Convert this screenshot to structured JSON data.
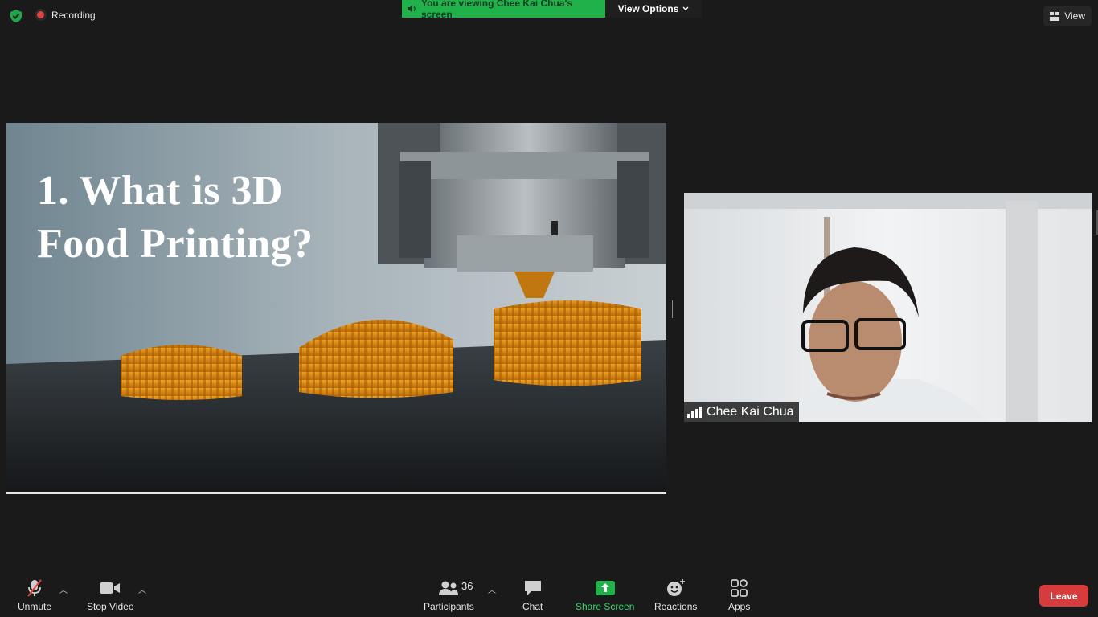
{
  "top": {
    "recording_label": "Recording",
    "viewing_banner": "You are viewing Chee Kai Chua's screen",
    "view_options_label": "View Options",
    "view_label": "View"
  },
  "shared_screen": {
    "slide_title_line1": "1. What is 3D",
    "slide_title_line2": "Food Printing?"
  },
  "participant": {
    "name": "Chee Kai Chua"
  },
  "toolbar": {
    "unmute_label": "Unmute",
    "stop_video_label": "Stop Video",
    "participants_label": "Participants",
    "participants_count": "36",
    "chat_label": "Chat",
    "share_screen_label": "Share Screen",
    "reactions_label": "Reactions",
    "apps_label": "Apps",
    "leave_label": "Leave"
  },
  "colors": {
    "background": "#1a1a1a",
    "banner_green": "#21b14b",
    "share_green": "#3fd46d",
    "leave_red": "#d83b3b",
    "recording_red": "#e0433f"
  }
}
